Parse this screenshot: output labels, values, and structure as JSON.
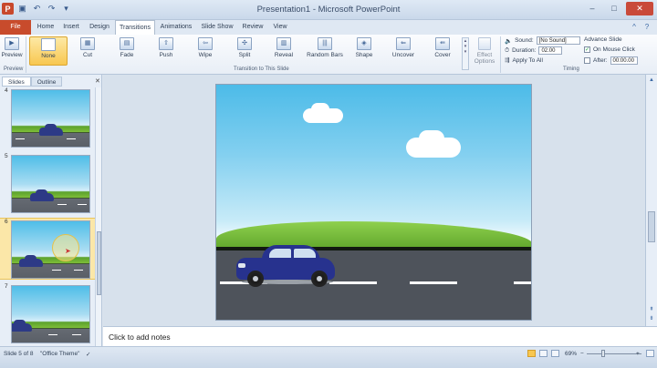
{
  "window": {
    "title": "Presentation1  -  Microsoft PowerPoint",
    "minimize_glyph": "–",
    "maximize_glyph": "□",
    "close_glyph": "✕"
  },
  "qat": {
    "app_glyph": "P",
    "save_glyph": "▣",
    "undo_glyph": "↶",
    "redo_glyph": "↷",
    "more_glyph": "▾"
  },
  "tabs": [
    "File",
    "Home",
    "Insert",
    "Design",
    "Transitions",
    "Animations",
    "Slide Show",
    "Review",
    "View"
  ],
  "active_tab": "Transitions",
  "help": {
    "minimize_ribbon_glyph": "^",
    "help_glyph": "?"
  },
  "ribbon": {
    "preview": {
      "label": "Preview",
      "group": "Preview",
      "glyph": "▶"
    },
    "transitions": [
      {
        "label": "None",
        "glyph": ""
      },
      {
        "label": "Cut",
        "glyph": "▦"
      },
      {
        "label": "Fade",
        "glyph": "▤"
      },
      {
        "label": "Push",
        "glyph": "⇧"
      },
      {
        "label": "Wipe",
        "glyph": "⇦"
      },
      {
        "label": "Split",
        "glyph": "✣"
      },
      {
        "label": "Reveal",
        "glyph": "▥"
      },
      {
        "label": "Random Bars",
        "glyph": "|||"
      },
      {
        "label": "Shape",
        "glyph": "◈"
      },
      {
        "label": "Uncover",
        "glyph": "⇐"
      },
      {
        "label": "Cover",
        "glyph": "⇚"
      }
    ],
    "gallery_arrows": "▴ ▾ ▾",
    "effect_options": "Effect Options",
    "group_transition": "Transition to This Slide",
    "timing": {
      "sound_label": "Sound:",
      "sound_value": "[No Sound]",
      "duration_label": "Duration:",
      "duration_value": "02.00",
      "apply_all": "Apply To All",
      "advance_label": "Advance Slide",
      "on_mouse_click": "On Mouse Click",
      "after_label": "After:",
      "after_value": "00:00.00",
      "group": "Timing"
    }
  },
  "slides_pane": {
    "tabs": [
      "Slides",
      "Outline"
    ],
    "close_glyph": "✕",
    "thumbs": [
      {
        "number": "4"
      },
      {
        "number": "5"
      },
      {
        "number": "6"
      },
      {
        "number": "7"
      }
    ]
  },
  "notes": {
    "placeholder": "Click to add notes"
  },
  "status": {
    "slide_info": "Slide 5 of 8",
    "theme": "\"Office Theme\"",
    "zoom": "69%",
    "minus": "−",
    "plus": "+"
  },
  "colors": {
    "file_tab": "#c84b2c",
    "selected_transition": "#f8c750",
    "car_body": "#27328e",
    "road": "#4e535b",
    "grass": "#5ea52a",
    "sky": "#4cbbe8"
  }
}
